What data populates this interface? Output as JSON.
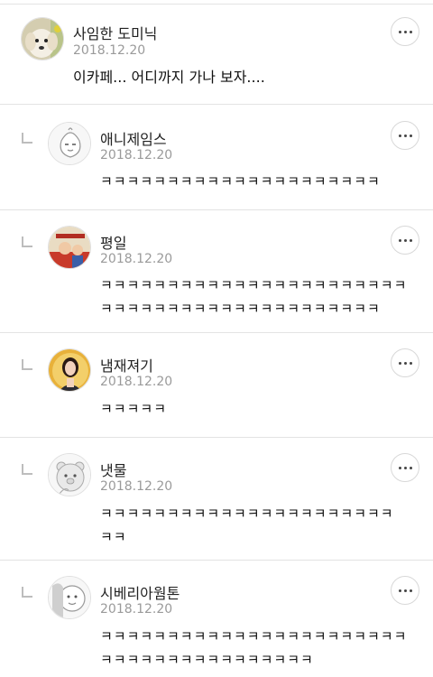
{
  "comments": [
    {
      "avatar_icon": "puppy-avatar-icon",
      "name": "사임한 도미닉",
      "date": "2018.12.20",
      "text": "이카페... 어디까지 가나 보자....",
      "is_reply": false
    },
    {
      "avatar_icon": "cartoon-avatar-icon",
      "name": "애니제임스",
      "date": "2018.12.20",
      "text": "ㅋㅋㅋㅋㅋㅋㅋㅋㅋㅋㅋㅋㅋㅋㅋㅋㅋㅋㅋㅋㅋ",
      "is_reply": true
    },
    {
      "avatar_icon": "poster-avatar-icon",
      "name": "평일",
      "date": "2018.12.20",
      "text": "ㅋㅋㅋㅋㅋㅋㅋㅋㅋㅋㅋㅋㅋㅋㅋㅋㅋㅋㅋㅋㅋㅋㅋㅋㅋㅋㅋㅋㅋㅋㅋㅋㅋㅋㅋㅋㅋㅋㅋㅋㅋㅋㅋㅋ",
      "is_reply": true
    },
    {
      "avatar_icon": "person-avatar-icon",
      "name": "냄재져기",
      "date": "2018.12.20",
      "text": "ㅋㅋㅋㅋㅋ",
      "is_reply": true
    },
    {
      "avatar_icon": "bear-avatar-icon",
      "name": "냇물",
      "date": "2018.12.20",
      "text": "ㅋㅋㅋㅋㅋㅋㅋㅋㅋㅋㅋㅋㅋㅋㅋㅋㅋㅋㅋㅋㅋㅋㅋㅋ",
      "is_reply": true
    },
    {
      "avatar_icon": "character-avatar-icon",
      "name": "시베리아웜톤",
      "date": "2018.12.20",
      "text": "ㅋㅋㅋㅋㅋㅋㅋㅋㅋㅋㅋㅋㅋㅋㅋㅋㅋㅋㅋㅋㅋㅋㅋㅋㅋㅋㅋㅋㅋㅋㅋㅋㅋㅋㅋㅋㅋㅋㅋ",
      "is_reply": true
    }
  ],
  "more_button_icon": "more-dots-icon",
  "reply_icon": "reply-arrow-icon"
}
